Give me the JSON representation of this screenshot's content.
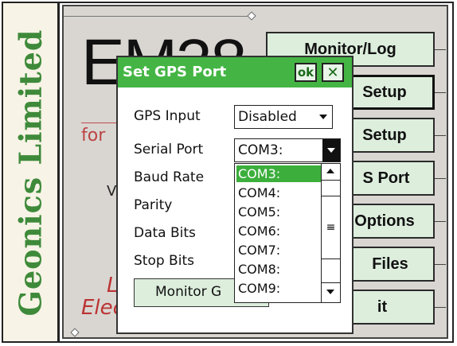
{
  "brand": {
    "name": "Geonics Limited"
  },
  "background": {
    "title": "EM38",
    "for_text": "for",
    "v_text": "V",
    "l_text": "L",
    "elec_text": "Elec"
  },
  "menu": {
    "items": [
      {
        "label": "Monitor/Log"
      },
      {
        "label": "Setup"
      },
      {
        "label": "Setup"
      },
      {
        "label": "S Port"
      },
      {
        "label": "Options"
      },
      {
        "label": "Files"
      },
      {
        "label": "it"
      }
    ]
  },
  "dialog": {
    "title": "Set GPS Port",
    "ok_label": "ok",
    "close_label": "✕",
    "fields": [
      {
        "label": "GPS Input",
        "value": "Disabled"
      },
      {
        "label": "Serial Port",
        "value": "COM3:"
      },
      {
        "label": "Baud Rate"
      },
      {
        "label": "Parity"
      },
      {
        "label": "Data Bits"
      },
      {
        "label": "Stop Bits"
      }
    ],
    "monitor_button": "Monitor G",
    "dropdown": {
      "options": [
        "COM3:",
        "COM4:",
        "COM5:",
        "COM6:",
        "COM7:",
        "COM8:",
        "COM9:"
      ],
      "selected": "COM3:",
      "thumb_glyph": "≡"
    }
  },
  "colors": {
    "accent": "#44b544",
    "brand": "#3e8a3a",
    "menu_bg": "#ddeedd",
    "screen_bg": "#d9d6d2"
  }
}
